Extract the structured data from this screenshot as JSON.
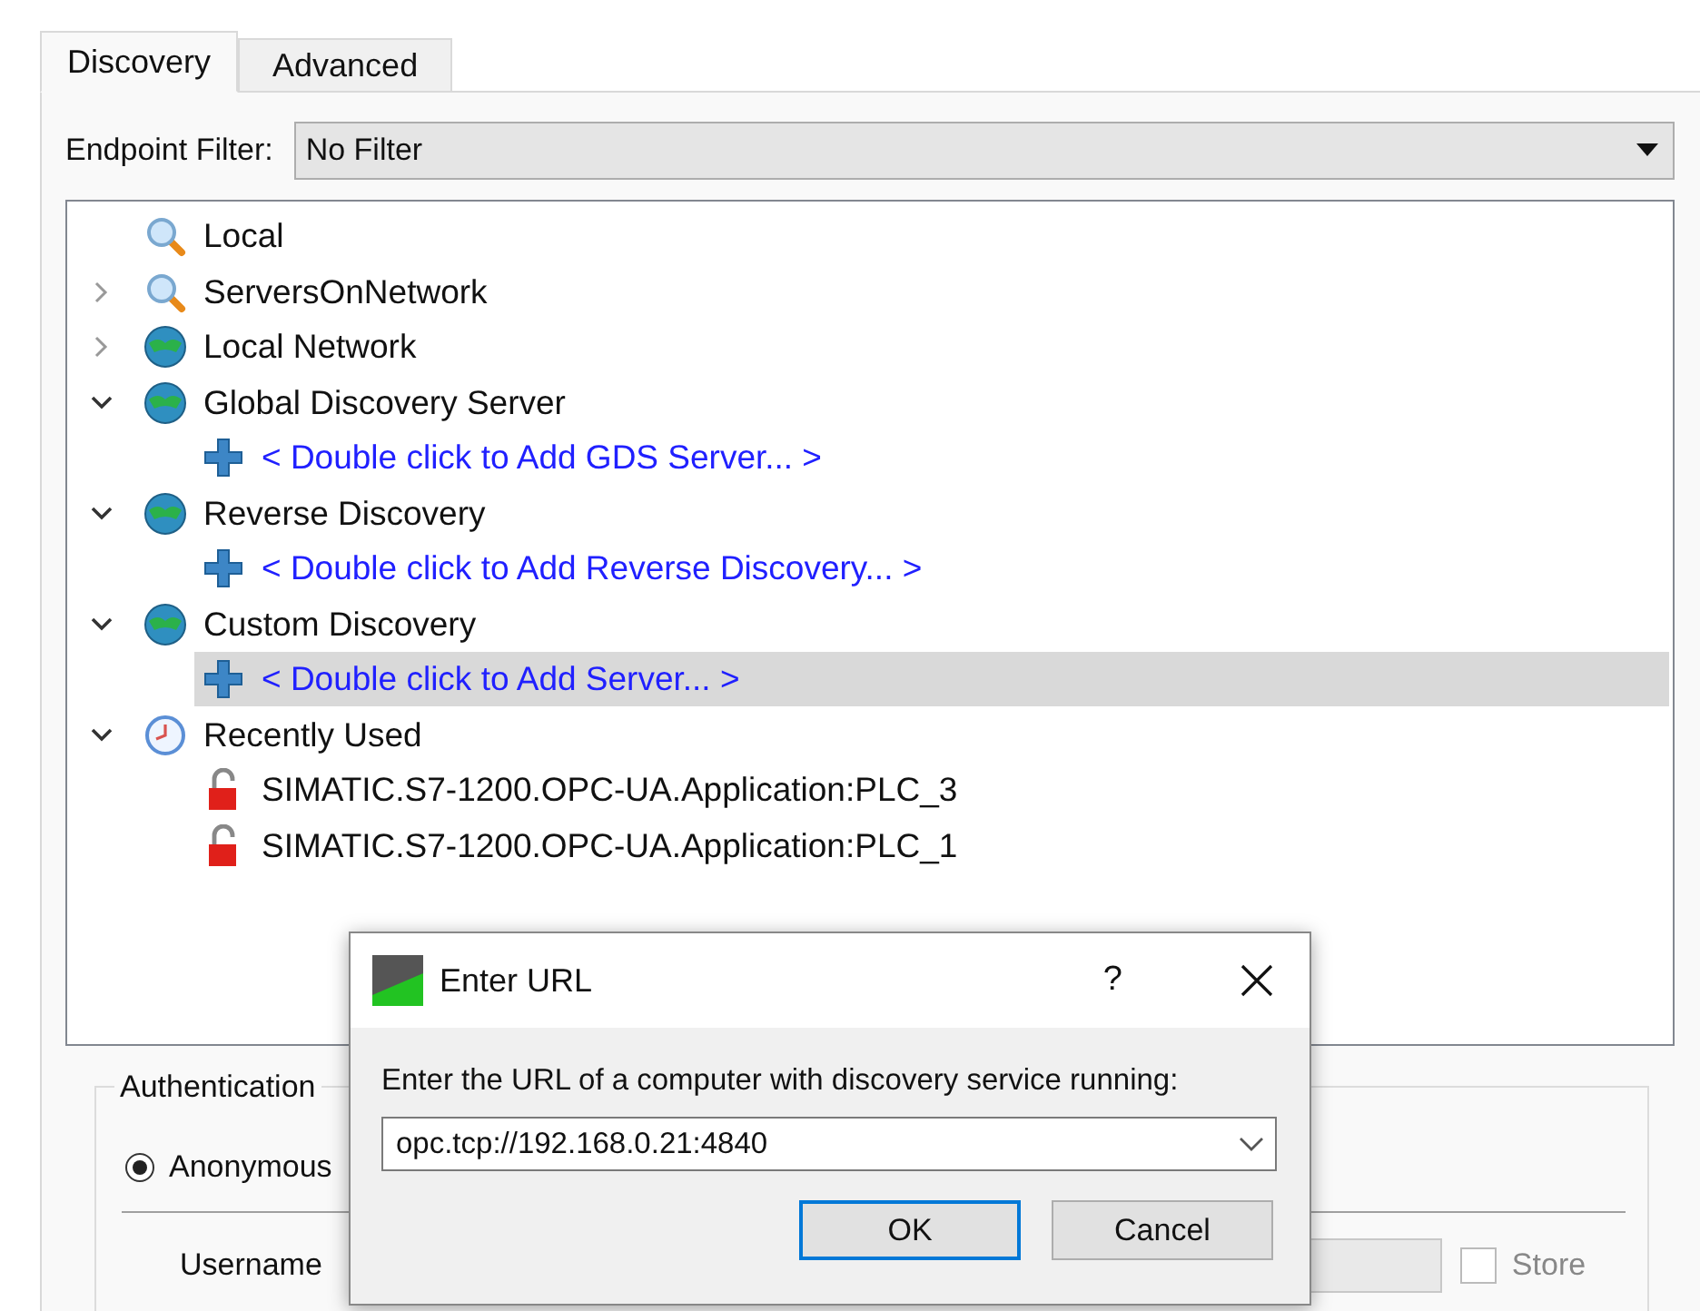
{
  "tabs": [
    {
      "label": "Discovery",
      "selected": true
    },
    {
      "label": "Advanced",
      "selected": false
    }
  ],
  "endpoint_filter": {
    "label": "Endpoint Filter:",
    "value": "No Filter"
  },
  "tree": [
    {
      "label": "Local",
      "kind": "search",
      "selected": false
    },
    {
      "label": "ServersOnNetwork",
      "kind": "search",
      "expanded": false,
      "selected": false
    },
    {
      "label": "Local Network",
      "kind": "globe",
      "expanded": false,
      "selected": false
    },
    {
      "label": "Global Discovery Server",
      "kind": "globe",
      "expanded": true,
      "selected": false,
      "children": [
        {
          "label": "< Double click to Add GDS Server... >",
          "kind": "add",
          "selected": false
        }
      ]
    },
    {
      "label": "Reverse Discovery",
      "kind": "globe",
      "expanded": true,
      "selected": false,
      "children": [
        {
          "label": "< Double click to Add Reverse Discovery... >",
          "kind": "add",
          "selected": false
        }
      ]
    },
    {
      "label": "Custom Discovery",
      "kind": "globe",
      "expanded": true,
      "selected": false,
      "children": [
        {
          "label": "< Double click to Add Server... >",
          "kind": "add",
          "selected": true
        }
      ]
    },
    {
      "label": "Recently Used",
      "kind": "clock",
      "expanded": true,
      "selected": false,
      "children": [
        {
          "label": "SIMATIC.S7-1200.OPC-UA.Application:PLC_3",
          "kind": "lock",
          "selected": false
        },
        {
          "label": "SIMATIC.S7-1200.OPC-UA.Application:PLC_1",
          "kind": "lock",
          "selected": false
        }
      ]
    }
  ],
  "authentication": {
    "title": "Authentication",
    "options": [
      {
        "label": "Anonymous",
        "selected": true
      }
    ],
    "username_label": "Username",
    "store": {
      "label": "Store",
      "checked": false
    }
  },
  "dialog": {
    "title": "Enter URL",
    "help": "?",
    "prompt": "Enter the URL of a computer with discovery service running:",
    "url": "opc.tcp://192.168.0.21:4840",
    "buttons": [
      {
        "label": "OK",
        "default": true
      },
      {
        "label": "Cancel",
        "default": false
      }
    ]
  }
}
